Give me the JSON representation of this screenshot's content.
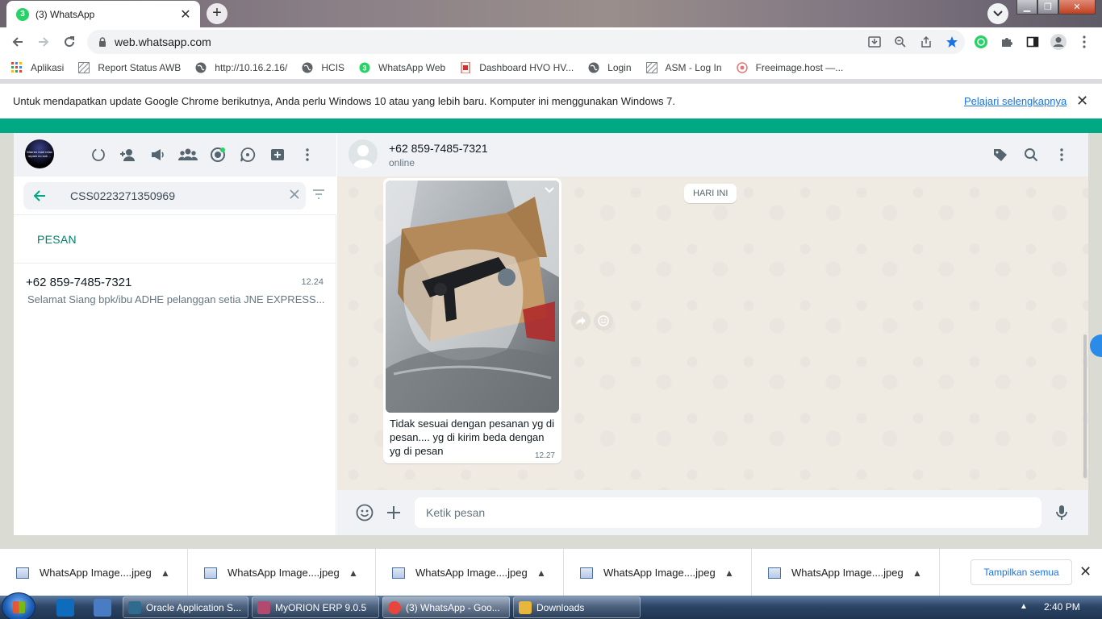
{
  "browser": {
    "tab_title": "(3) WhatsApp",
    "tab_badge": "3",
    "url": "web.whatsapp.com",
    "bookmarks": [
      {
        "label": "Aplikasi",
        "icon": "apps-grid-icon"
      },
      {
        "label": "Report Status AWB",
        "icon": "broken-image-icon"
      },
      {
        "label": "http://10.16.2.16/",
        "icon": "globe-icon"
      },
      {
        "label": "HCIS",
        "icon": "globe-icon"
      },
      {
        "label": "WhatsApp Web",
        "icon": "whatsapp-icon"
      },
      {
        "label": "Dashboard HVO HV...",
        "icon": "dashboard-icon"
      },
      {
        "label": "Login",
        "icon": "globe-icon"
      },
      {
        "label": "ASM - Log In",
        "icon": "broken-image-icon"
      },
      {
        "label": "Freeimage.host —...",
        "icon": "freeimage-icon"
      }
    ],
    "infobar": {
      "message": "Untuk mendapatkan update Google Chrome berikutnya, Anda perlu Windows 10 atau yang lebih baru. Komputer ini menggunakan Windows 7.",
      "link": "Pelajari selengkapnya"
    }
  },
  "whatsapp": {
    "profile_avatar_text": "Warren mari relax repam no sok ...",
    "search": {
      "value": "CSS0223271350969"
    },
    "section_label": "PESAN",
    "results": [
      {
        "name": "+62 859-7485-7321",
        "time": "12.24",
        "preview": "Selamat Siang   bpk/ibu ADHE pelanggan setia JNE EXPRESS..."
      }
    ],
    "chat": {
      "contact": "+62 859-7485-7321",
      "status": "online",
      "date_chip": "HARI INI",
      "message": {
        "caption": "Tidak sesuai dengan pesanan yg di pesan.... yg di kirim beda dengan yg di pesan",
        "time": "12.27"
      },
      "composer_placeholder": "Ketik pesan"
    }
  },
  "downloads": {
    "items": [
      "WhatsApp Image....jpeg",
      "WhatsApp Image....jpeg",
      "WhatsApp Image....jpeg",
      "WhatsApp Image....jpeg",
      "WhatsApp Image....jpeg"
    ],
    "show_all": "Tampilkan semua"
  },
  "taskbar": {
    "tasks": [
      {
        "label": "Oracle Application S...",
        "icon_color": "#2e6b8f"
      },
      {
        "label": "MyORION ERP 9.0.5",
        "icon_color": "#b24a6f"
      },
      {
        "label": "(3) WhatsApp - Goo...",
        "icon_color": "#e8453c"
      },
      {
        "label": "Downloads",
        "icon_color": "#e6b73a"
      }
    ],
    "clock": "2:40 PM"
  },
  "colors": {
    "whatsapp_green": "#00a884",
    "whatsapp_teal": "#008069",
    "chrome_blue": "#1a73e8"
  }
}
